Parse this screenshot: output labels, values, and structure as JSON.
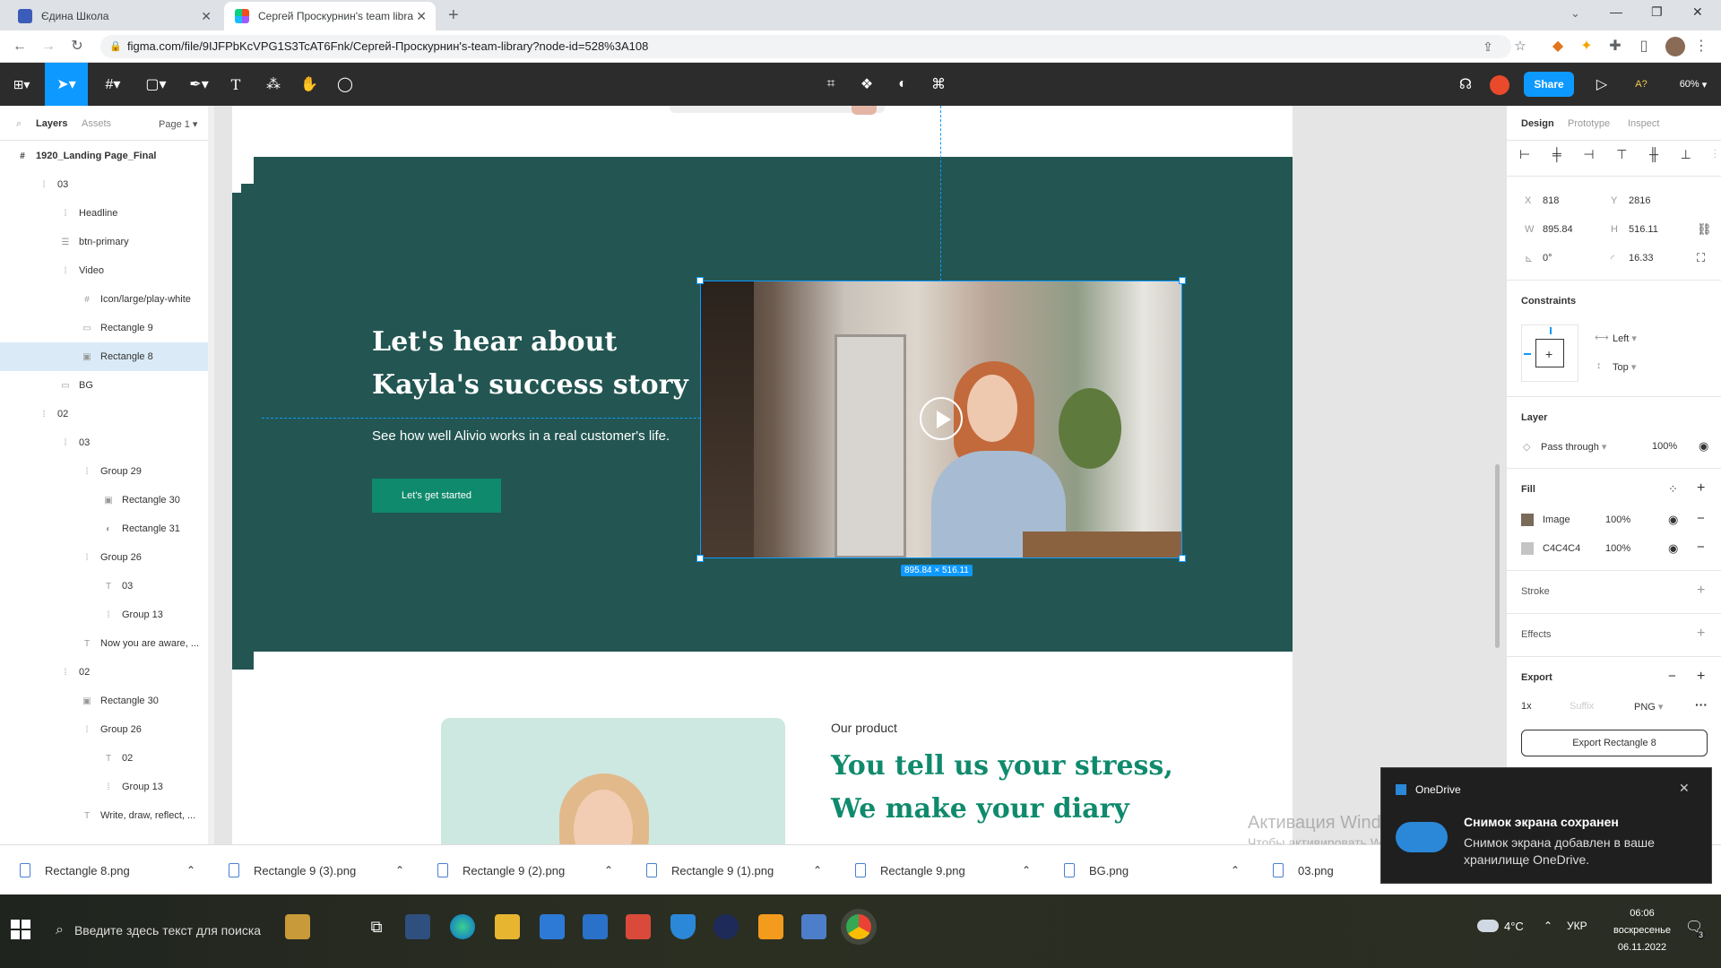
{
  "browser": {
    "tabs": [
      {
        "title": "Єдина Школа",
        "active": false
      },
      {
        "title": "Сергей Проскурнин's team libra",
        "active": true
      }
    ],
    "new_tab": "+",
    "url": "figma.com/file/9IJFPbKcVPG1S3TcAT6Fnk/Сергей-Проскурнин's-team-library?node-id=528%3A108"
  },
  "figma_toolbar": {
    "share_label": "Share",
    "zoom_label": "60%",
    "a_label": "A?"
  },
  "left_panel": {
    "tabs": [
      "Layers",
      "Assets"
    ],
    "page_label": "Page 1",
    "frame_name": "1920_Landing Page_Final",
    "layers": [
      {
        "name": "03",
        "indent": 1,
        "icon": "group",
        "selected": false
      },
      {
        "name": "Headline",
        "indent": 2,
        "icon": "group",
        "selected": false
      },
      {
        "name": "btn-primary",
        "indent": 2,
        "icon": "component",
        "selected": false
      },
      {
        "name": "Video",
        "indent": 2,
        "icon": "group",
        "selected": false
      },
      {
        "name": "Icon/large/play-white",
        "indent": 3,
        "icon": "frame",
        "selected": false
      },
      {
        "name": "Rectangle 9",
        "indent": 3,
        "icon": "rect",
        "selected": false
      },
      {
        "name": "Rectangle 8",
        "indent": 3,
        "icon": "image",
        "selected": true
      },
      {
        "name": "BG",
        "indent": 2,
        "icon": "rect",
        "selected": false
      },
      {
        "name": "02",
        "indent": 1,
        "icon": "group",
        "selected": false
      },
      {
        "name": "03",
        "indent": 2,
        "icon": "group",
        "selected": false
      },
      {
        "name": "Group 29",
        "indent": 3,
        "icon": "group",
        "selected": false
      },
      {
        "name": "Rectangle 30",
        "indent": 4,
        "icon": "image",
        "selected": false
      },
      {
        "name": "Rectangle 31",
        "indent": 4,
        "icon": "ellipse",
        "selected": false
      },
      {
        "name": "Group 26",
        "indent": 3,
        "icon": "group",
        "selected": false
      },
      {
        "name": "03",
        "indent": 4,
        "icon": "text",
        "selected": false
      },
      {
        "name": "Group 13",
        "indent": 4,
        "icon": "group",
        "selected": false
      },
      {
        "name": "Now you are aware, ...",
        "indent": 3,
        "icon": "text",
        "selected": false
      },
      {
        "name": "02",
        "indent": 2,
        "icon": "group",
        "selected": false
      },
      {
        "name": "Rectangle 30",
        "indent": 3,
        "icon": "image",
        "selected": false
      },
      {
        "name": "Group 26",
        "indent": 3,
        "icon": "group",
        "selected": false
      },
      {
        "name": "02",
        "indent": 4,
        "icon": "text",
        "selected": false
      },
      {
        "name": "Group 13",
        "indent": 4,
        "icon": "group",
        "selected": false
      },
      {
        "name": "Write, draw, reflect, ...",
        "indent": 3,
        "icon": "text",
        "selected": false
      }
    ]
  },
  "canvas": {
    "headline_line1": "Let's hear about",
    "headline_line2": "Kayla's success story",
    "subtitle": "See how well Alivio works in a real customer's life.",
    "cta_label": "Let's get started",
    "size_badge": "895.84 × 516.11",
    "product_eyebrow": "Our product",
    "product_line1": "You tell us your stress,",
    "product_line2": "We make your diary",
    "bg_color": "#235652",
    "accent_color": "#0f8a6c"
  },
  "right_panel": {
    "tabs": [
      "Design",
      "Prototype",
      "Inspect"
    ],
    "x": "818",
    "y": "2816",
    "w": "895.84",
    "h": "516.11",
    "rotation": "0°",
    "radius": "16.33",
    "constraints_title": "Constraints",
    "constraint_h": "Left",
    "constraint_v": "Top",
    "layer_title": "Layer",
    "blend": "Pass through",
    "opacity": "100%",
    "fill_title": "Fill",
    "fills": [
      {
        "name": "Image",
        "opacity": "100%",
        "swatch": "#7a6a5a"
      },
      {
        "name": "C4C4C4",
        "opacity": "100%",
        "swatch": "#c4c4c4"
      }
    ],
    "stroke_title": "Stroke",
    "effects_title": "Effects",
    "export_title": "Export",
    "export_scale": "1x",
    "export_suffix": "Suffix",
    "export_format": "PNG",
    "export_button": "Export Rectangle 8"
  },
  "downloads": [
    "Rectangle 8.png",
    "Rectangle 9 (3).png",
    "Rectangle 9 (2).png",
    "Rectangle 9 (1).png",
    "Rectangle 9.png",
    "BG.png",
    "03.png"
  ],
  "watermark": {
    "line1": "Активация Windows",
    "line2": "Чтобы активировать Windows, перейдите в раздел \"Параметры\"."
  },
  "toast": {
    "app": "OneDrive",
    "title": "Снимок экрана сохранен",
    "body": "Снимок экрана добавлен в ваше хранилище OneDrive."
  },
  "taskbar": {
    "search_placeholder": "Введите здесь текст для поиска",
    "weather": "4°C",
    "lang": "УКР",
    "time": "06:06",
    "day": "воскресенье",
    "date": "06.11.2022",
    "notifications": "3"
  }
}
